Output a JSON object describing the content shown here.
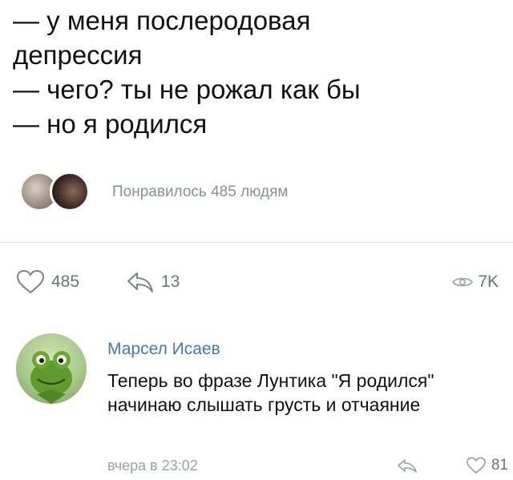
{
  "post": {
    "lines": [
      "— у меня послеродовая",
      "депрессия",
      "— чего? ты не рожал как бы",
      "— но я родился"
    ]
  },
  "likes_summary": {
    "text": "Понравилось 485 людям"
  },
  "actions": {
    "likes": "485",
    "shares": "13",
    "views": "7K"
  },
  "comment": {
    "author": "Марсел Исаев",
    "text": "Теперь во фразе Лунтика \"Я родился\" начинаю слышать грусть и отчаяние",
    "time": "вчера в 23:02",
    "likes": "81"
  },
  "colors": {
    "link": "#4a76a8",
    "muted": "#9aa0a6",
    "icon": "#6b7179"
  },
  "icons": {
    "like": "heart-outline-icon",
    "share": "share-arrow-icon",
    "views": "eye-icon",
    "reply": "reply-arrow-icon"
  }
}
